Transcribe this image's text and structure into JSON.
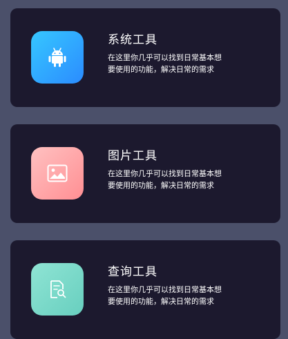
{
  "colors": {
    "background": "#4b506a",
    "card": "#1c192e",
    "text": "#ffffff"
  },
  "cards": [
    {
      "title": "系统工具",
      "description": "在这里你几乎可以找到日常基本想要使用的功能，解决日常的需求",
      "icon": "android-icon",
      "tile_color": "#2b9bff"
    },
    {
      "title": "图片工具",
      "description": "在这里你几乎可以找到日常基本想要使用的功能，解决日常的需求",
      "icon": "image-icon",
      "tile_color": "#ffa4a7"
    },
    {
      "title": "查询工具",
      "description": "在这里你几乎可以找到日常基本想要使用的功能，解决日常的需求",
      "icon": "document-search-icon",
      "tile_color": "#7cdacb"
    }
  ]
}
